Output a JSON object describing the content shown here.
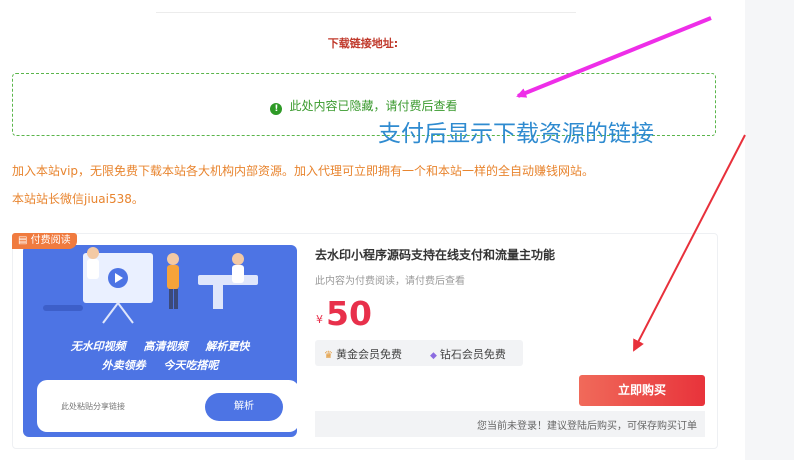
{
  "download": {
    "label": "下载链接地址:"
  },
  "hidden_notice": {
    "text": "此处内容已隐藏，请付费后查看"
  },
  "overlay": {
    "annotation": "支付后显示下载资源的链接"
  },
  "vip_text": {
    "line1": "加入本站vip，无限免费下载本站各大机构内部资源。加入代理可立即拥有一个和本站一样的全自动赚钱网站。",
    "line2": "本站站长微信jiuai538。"
  },
  "product": {
    "badge": "付费阅读",
    "title": "去水印小程序源码支持在线支付和流量主功能",
    "subtitle": "此内容为付费阅读，请付费后查看",
    "currency": "¥",
    "price": "50",
    "tags": [
      "黄金会员免费",
      "钻石会员免费"
    ],
    "buy_label": "立即购买",
    "login_notice": "您当前未登录！建议登陆后购买，可保存购买订单"
  },
  "thumbnail": {
    "features_line1": "无水印视频 高清视频 解析更快",
    "features_line2": "外卖领券 今天吃搭呢",
    "input_placeholder": "此处粘贴分享链接",
    "parse_button": "解析"
  },
  "colors": {
    "annotation_arrow": "#ee2ee8",
    "red_arrow": "#e8303b",
    "hidden_green": "#3a9a2e",
    "price_red": "#e8304b",
    "vip_orange": "#e8842e"
  }
}
